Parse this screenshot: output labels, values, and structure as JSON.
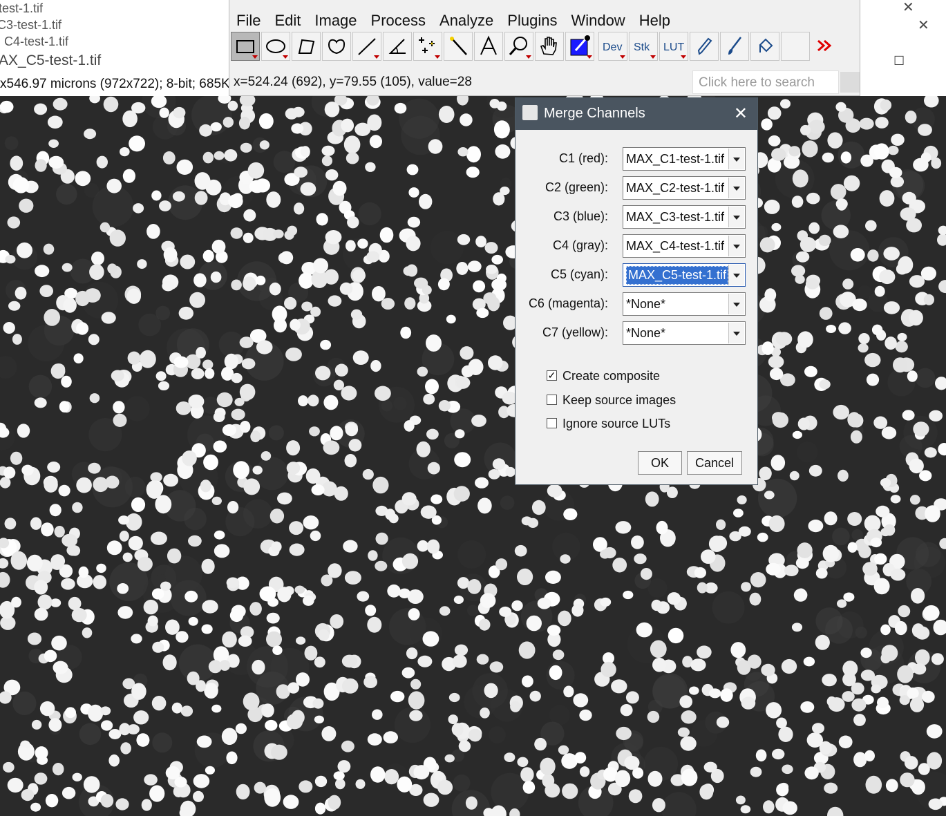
{
  "background_windows": {
    "win1_title": "test-1.tif",
    "win2_title": "C3-test-1.tif",
    "win3_title": "C4-test-1.tif",
    "win4_title": "AX_C5-test-1.tif",
    "win4_info": "x546.97 microns (972x722); 8-bit; 685K"
  },
  "imagej": {
    "menus": [
      "File",
      "Edit",
      "Image",
      "Process",
      "Analyze",
      "Plugins",
      "Window",
      "Help"
    ],
    "tools": [
      "rectangle-selection",
      "oval-selection",
      "polygon-selection",
      "freehand-selection",
      "line-selection",
      "angle-tool",
      "multipoint-tool",
      "wand-tool",
      "text-tool",
      "magnifying-glass",
      "scrolling-tool",
      "color-picker",
      "Dev",
      "Stk",
      "LUT",
      "pencil",
      "paintbrush",
      "flood-filler",
      "more-tools"
    ],
    "dev_label": "Dev",
    "stk_label": "Stk",
    "lut_label": "LUT",
    "status": "x=524.24 (692), y=79.55 (105), value=28",
    "search_placeholder": "Click here to search"
  },
  "dialog": {
    "title": "Merge Channels",
    "channels": [
      {
        "label": "C1 (red):",
        "value": "MAX_C1-test-1.tif"
      },
      {
        "label": "C2 (green):",
        "value": "MAX_C2-test-1.tif"
      },
      {
        "label": "C3 (blue):",
        "value": "MAX_C3-test-1.tif"
      },
      {
        "label": "C4 (gray):",
        "value": "MAX_C4-test-1.tif"
      },
      {
        "label": "C5 (cyan):",
        "value": "MAX_C5-test-1.tif"
      },
      {
        "label": "C6 (magenta):",
        "value": "*None*"
      },
      {
        "label": "C7 (yellow):",
        "value": "*None*"
      }
    ],
    "options": [
      {
        "label": "Create composite",
        "checked": true
      },
      {
        "label": "Keep source images",
        "checked": false
      },
      {
        "label": "Ignore source LUTs",
        "checked": false
      }
    ],
    "ok_label": "OK",
    "cancel_label": "Cancel"
  },
  "colors": {
    "dialog_titlebar": "#4a5560",
    "selection_highlight": "#3470d0",
    "dropdown_indicator": "#c00000",
    "more_tools_arrow": "#e00000"
  }
}
